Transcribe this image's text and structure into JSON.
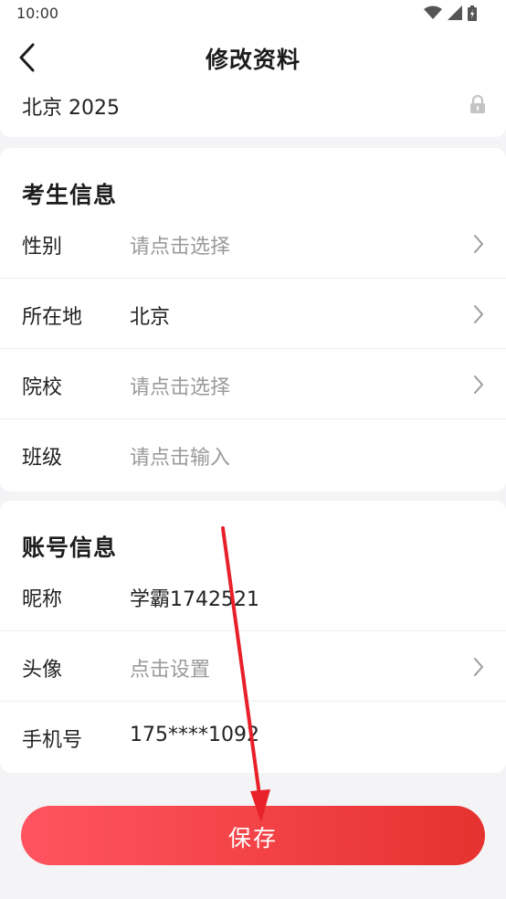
{
  "status_bar": {
    "time": "10:00",
    "icons": [
      "wifi-icon",
      "signal-icon",
      "battery-icon"
    ]
  },
  "header": {
    "title": "修改资料",
    "back_icon": "chevron-left-icon"
  },
  "exam": {
    "value": "北京 2025",
    "lock_icon": "lock-icon"
  },
  "student_section": {
    "title": "考生信息",
    "rows": [
      {
        "label": "性别",
        "value": "请点击选择",
        "placeholder": true,
        "chevron": true
      },
      {
        "label": "所在地",
        "value": "北京",
        "placeholder": false,
        "chevron": true
      },
      {
        "label": "院校",
        "value": "请点击选择",
        "placeholder": true,
        "chevron": true
      },
      {
        "label": "班级",
        "value": "请点击输入",
        "placeholder": true,
        "chevron": false
      }
    ]
  },
  "account_section": {
    "title": "账号信息",
    "rows": [
      {
        "label": "昵称",
        "value": "学霸1742521",
        "placeholder": false,
        "chevron": false
      },
      {
        "label": "头像",
        "value": "点击设置",
        "placeholder": true,
        "chevron": true
      },
      {
        "label": "手机号",
        "value": "175****1092",
        "placeholder": false,
        "chevron": false
      }
    ]
  },
  "save_button": {
    "label": "保存"
  },
  "colors": {
    "accent_start": "#ff5460",
    "accent_end": "#e6322f",
    "annotation_arrow": "#e8202a",
    "placeholder_text": "#9a9a9a"
  }
}
